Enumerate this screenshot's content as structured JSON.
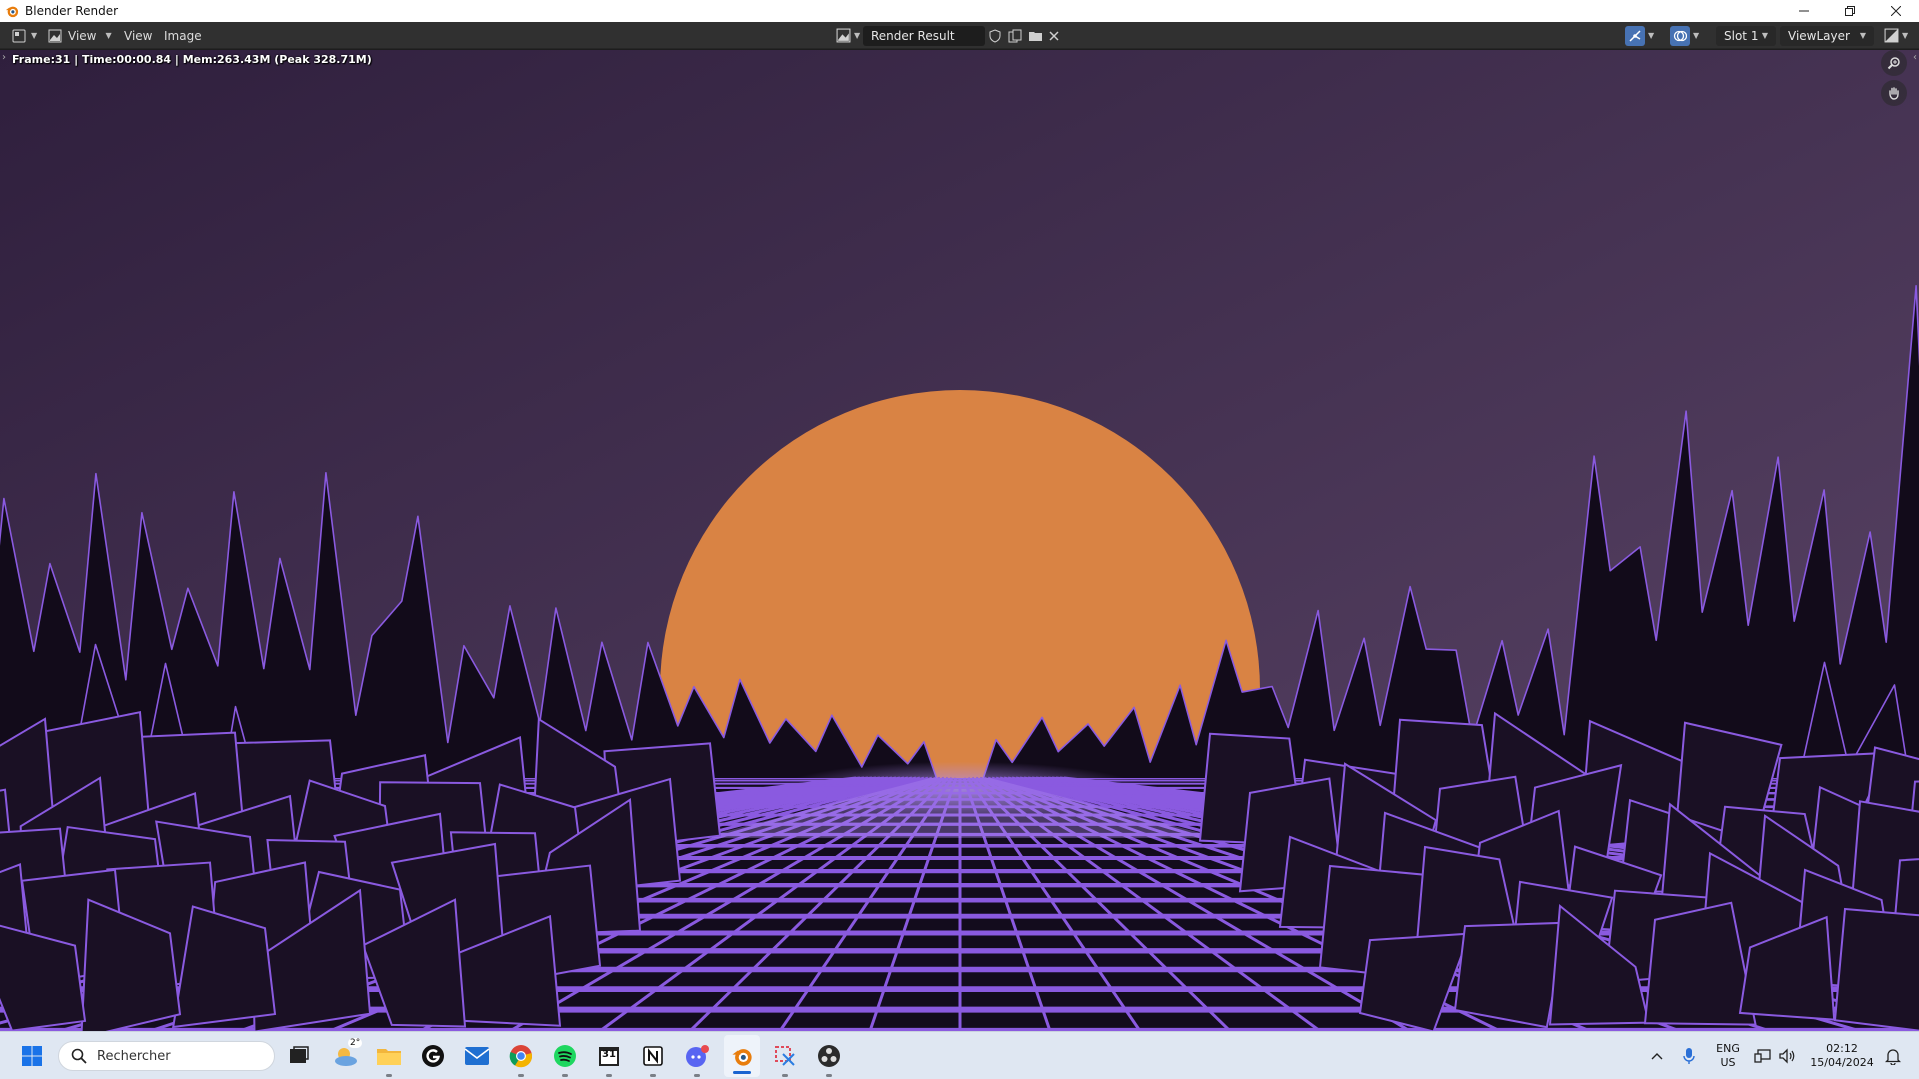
{
  "window": {
    "title": "Blender Render",
    "controls": [
      "minimize",
      "restore",
      "close"
    ]
  },
  "header": {
    "menus": [
      "View",
      "View",
      "Image"
    ],
    "image_name": "Render Result",
    "slot": "Slot 1",
    "view_layer": "ViewLayer"
  },
  "render": {
    "stats": "Frame:31 | Time:00:00.84 | Mem:263.43M (Peak 328.71M)",
    "scene": "synthwave landscape: orange sun above a purple wireframe grid road between low-poly mountains",
    "colors": {
      "sky_top": "#2f1f3d",
      "sky_bottom": "#5c4668",
      "sun": "#d98344",
      "wire": "#8a5ae0",
      "mountain": "#120b1a",
      "road_glow": "#b08cf0"
    }
  },
  "taskbar": {
    "search_placeholder": "Rechercher",
    "weather_badge": "2°",
    "calendar_day": "31",
    "apps": [
      "start",
      "task-view",
      "widgets",
      "file-explorer",
      "g-app",
      "mail",
      "chrome",
      "spotify",
      "calendar",
      "notion",
      "discord",
      "blender",
      "snipping-tool",
      "obs"
    ],
    "language_line1": "ENG",
    "language_line2": "US",
    "time": "02:12",
    "date": "15/04/2024",
    "colors": {
      "accent": "#1a64d0"
    }
  }
}
